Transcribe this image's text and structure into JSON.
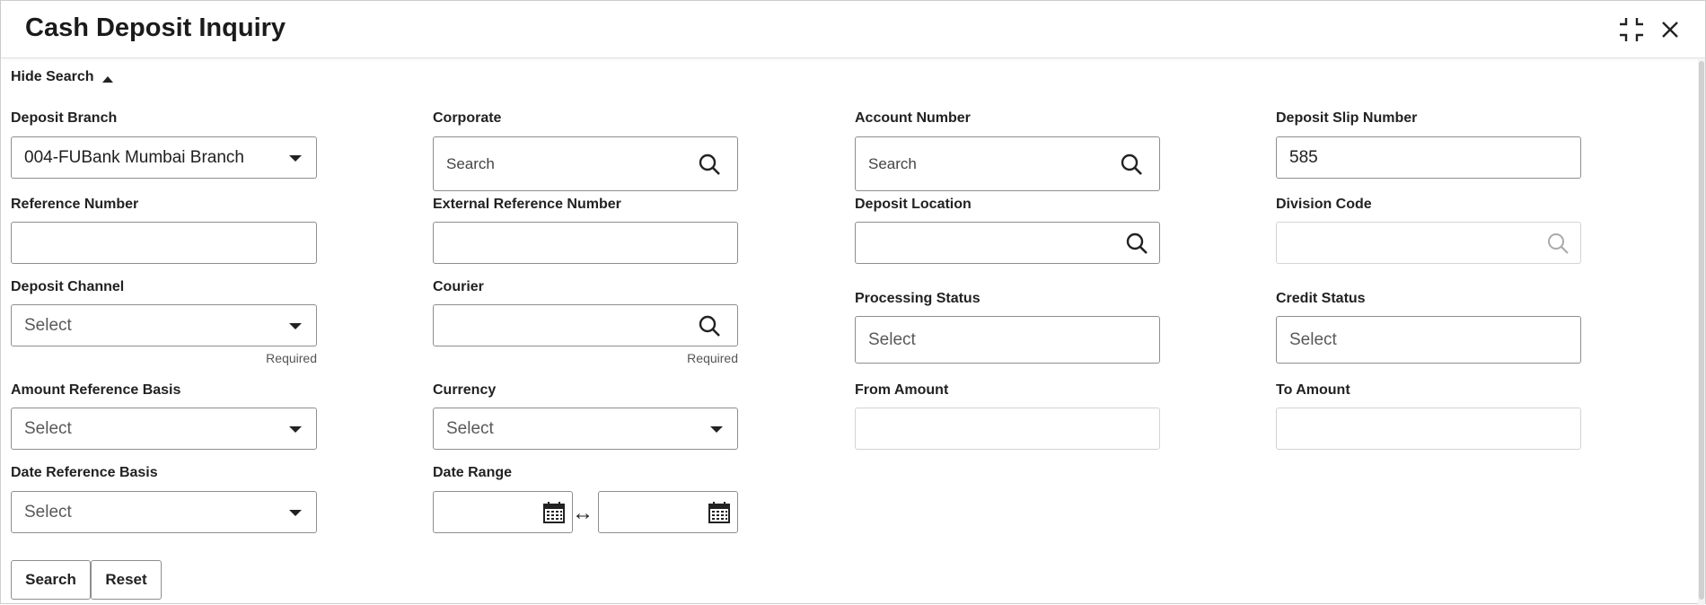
{
  "window": {
    "title": "Cash Deposit Inquiry"
  },
  "search_toggle": {
    "label": "Hide Search"
  },
  "fields": {
    "deposit_branch": {
      "label": "Deposit Branch",
      "value": "004-FUBank Mumbai Branch"
    },
    "corporate": {
      "label": "Corporate",
      "placeholder": "Search"
    },
    "account_number": {
      "label": "Account Number",
      "placeholder": "Search"
    },
    "deposit_slip_number": {
      "label": "Deposit Slip Number",
      "value": "585"
    },
    "reference_number": {
      "label": "Reference Number",
      "value": ""
    },
    "external_reference_number": {
      "label": "External Reference Number",
      "value": ""
    },
    "deposit_location": {
      "label": "Deposit Location",
      "value": ""
    },
    "division_code": {
      "label": "Division Code",
      "value": ""
    },
    "deposit_channel": {
      "label": "Deposit Channel",
      "placeholder": "Select",
      "hint": "Required"
    },
    "courier": {
      "label": "Courier",
      "value": "",
      "hint": "Required"
    },
    "processing_status": {
      "label": "Processing Status",
      "placeholder": "Select"
    },
    "credit_status": {
      "label": "Credit Status",
      "placeholder": "Select"
    },
    "amount_reference_basis": {
      "label": "Amount Reference Basis",
      "placeholder": "Select"
    },
    "currency": {
      "label": "Currency",
      "placeholder": "Select"
    },
    "from_amount": {
      "label": "From Amount",
      "value": ""
    },
    "to_amount": {
      "label": "To Amount",
      "value": ""
    },
    "date_reference_basis": {
      "label": "Date Reference Basis",
      "placeholder": "Select"
    },
    "date_range": {
      "label": "Date Range",
      "separator": "↔"
    }
  },
  "buttons": {
    "search": "Search",
    "reset": "Reset"
  },
  "icons": {
    "minimize": "collapse-icon",
    "close": "close-icon",
    "search": "search-icon",
    "calendar": "calendar-icon",
    "dropdown": "chevron-down-icon"
  },
  "colors": {
    "border": "#8e8e8e",
    "disabled_border": "#d3d3d3",
    "text": "#1f1f1f"
  }
}
